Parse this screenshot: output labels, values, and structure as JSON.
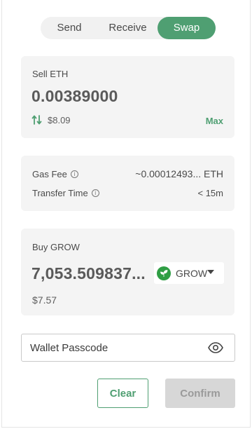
{
  "tabs": {
    "send": "Send",
    "receive": "Receive",
    "swap": "Swap",
    "active": "swap"
  },
  "sell": {
    "label": "Sell ETH",
    "amount": "0.00389000",
    "usd_value": "$8.09",
    "max_label": "Max",
    "swap_icon": "swap-arrows-icon"
  },
  "fees": {
    "gas_fee_label": "Gas Fee",
    "gas_fee_value": "~0.00012493... ETH",
    "transfer_time_label": "Transfer Time",
    "transfer_time_value": "< 15m",
    "info_icon": "info-icon"
  },
  "buy": {
    "label": "Buy GROW",
    "amount": "7,053.509837...",
    "usd_value": "$7.57",
    "token": "GROW",
    "token_icon": "grow-leaf-icon"
  },
  "passcode": {
    "placeholder": "Wallet Passcode",
    "value": "",
    "eye_icon": "eye-icon"
  },
  "buttons": {
    "clear": "Clear",
    "confirm": "Confirm"
  },
  "colors": {
    "accent": "#4f9f72",
    "card_bg": "#f4f4f4",
    "disabled_bg": "#d7d7d7",
    "disabled_text": "#9a9a9a"
  }
}
